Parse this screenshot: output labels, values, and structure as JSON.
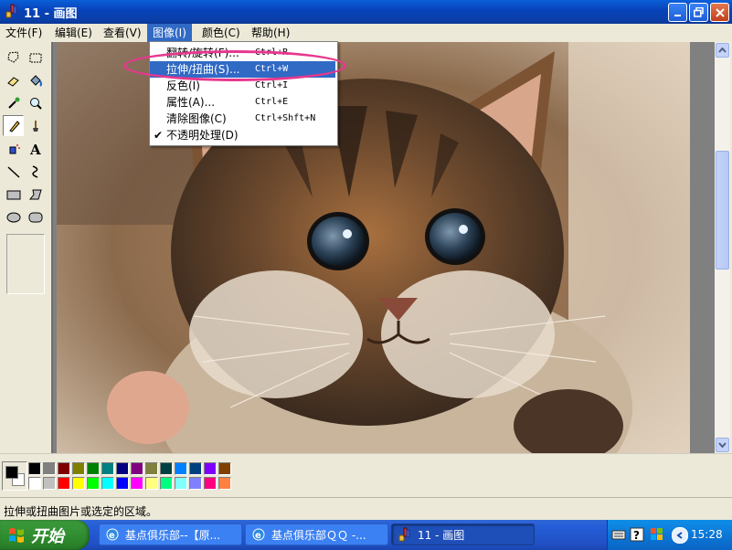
{
  "window": {
    "title": "11 - 画图",
    "buttons": {
      "minimize": "minimize",
      "maximize": "maximize",
      "close": "close"
    }
  },
  "menubar": {
    "items": [
      {
        "label": "文件(F)"
      },
      {
        "label": "编辑(E)"
      },
      {
        "label": "查看(V)"
      },
      {
        "label": "图像(I)"
      },
      {
        "label": "颜色(C)"
      },
      {
        "label": "帮助(H)"
      }
    ]
  },
  "image_menu": {
    "items": [
      {
        "label": "翻转/旋转(F)...",
        "shortcut": "Ctrl+R"
      },
      {
        "label": "拉伸/扭曲(S)...",
        "shortcut": "Ctrl+W"
      },
      {
        "label": "反色(I)",
        "shortcut": "Ctrl+I"
      },
      {
        "label": "属性(A)...",
        "shortcut": "Ctrl+E"
      },
      {
        "label": "清除图像(C)",
        "shortcut": "Ctrl+Shft+N"
      },
      {
        "label": "不透明处理(D)",
        "shortcut": "",
        "checked": true
      }
    ],
    "checkmark": "✔",
    "highlight_color": "#316ac5",
    "annotation_color": "#e6388e"
  },
  "palette": {
    "foreground": "#000000",
    "background": "#ffffff",
    "row1": [
      "#000000",
      "#808080",
      "#800000",
      "#808000",
      "#008000",
      "#008080",
      "#000080",
      "#800080",
      "#808040",
      "#004040",
      "#0080ff",
      "#004080",
      "#8000ff",
      "#804000"
    ],
    "row2": [
      "#ffffff",
      "#c0c0c0",
      "#ff0000",
      "#ffff00",
      "#00ff00",
      "#00ffff",
      "#0000ff",
      "#ff00ff",
      "#ffff80",
      "#00ff80",
      "#80ffff",
      "#8080ff",
      "#ff0080",
      "#ff8040"
    ]
  },
  "status": {
    "text": "拉伸或扭曲图片或选定的区域。"
  },
  "taskbar": {
    "start_label": "开始",
    "tasks": [
      {
        "label": "基点俱乐部--【原..."
      },
      {
        "label": "基点俱乐部ＱＱ -..."
      },
      {
        "label": "11 - 画图"
      }
    ],
    "clock": "15:28"
  }
}
